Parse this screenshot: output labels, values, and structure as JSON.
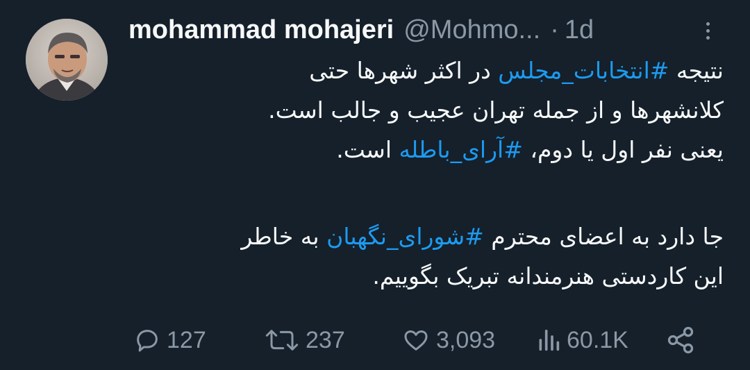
{
  "tweet": {
    "author": {
      "display_name": "mohammad mohajeri",
      "handle": "@Mohmo...",
      "separator": "·",
      "time": "1d"
    },
    "body": {
      "p1_line1_pre": "نتیجه ",
      "p1_line1_tag": "#انتخابات_مجلس",
      "p1_line1_post": " در اکثر شهرها حتی",
      "p1_line2": "کلانشهرها و از جمله تهران عجیب و جالب است.",
      "p1_line3_pre": "یعنی نفر اول یا دوم، ",
      "p1_line3_tag": "#آرای_باطله",
      "p1_line3_post": " است.",
      "p2_line1_pre": "جا دارد به اعضای محترم ",
      "p2_line1_tag": "#شورای_نگهبان",
      "p2_line1_post": " به خاطر",
      "p2_line2": "این کاردستی هنرمندانه تبریک بگوییم."
    },
    "actions": {
      "replies": "127",
      "retweets": "237",
      "likes": "3,093",
      "views": "60.1K"
    },
    "icons": {
      "reply": "reply-icon",
      "retweet": "retweet-icon",
      "like": "heart-icon",
      "views": "views-icon",
      "share": "share-icon",
      "more": "more-icon"
    },
    "colors": {
      "background": "#15202b",
      "text": "#f7f9f9",
      "muted": "#8b98a5",
      "accent": "#1d9bf0"
    }
  }
}
